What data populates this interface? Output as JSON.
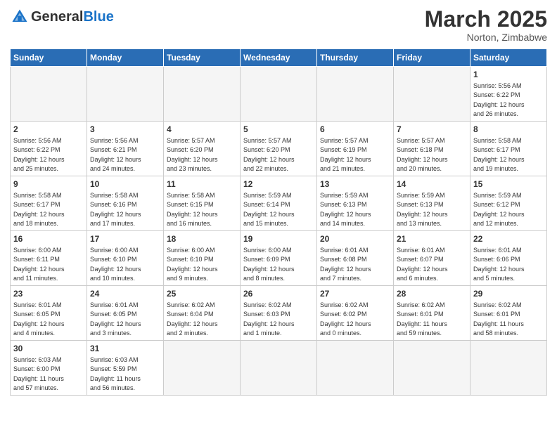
{
  "header": {
    "logo_general": "General",
    "logo_blue": "Blue",
    "month_title": "March 2025",
    "location": "Norton, Zimbabwe"
  },
  "weekdays": [
    "Sunday",
    "Monday",
    "Tuesday",
    "Wednesday",
    "Thursday",
    "Friday",
    "Saturday"
  ],
  "weeks": [
    [
      {
        "day": "",
        "info": "",
        "empty": true
      },
      {
        "day": "",
        "info": "",
        "empty": true
      },
      {
        "day": "",
        "info": "",
        "empty": true
      },
      {
        "day": "",
        "info": "",
        "empty": true
      },
      {
        "day": "",
        "info": "",
        "empty": true
      },
      {
        "day": "",
        "info": "",
        "empty": true
      },
      {
        "day": "1",
        "info": "Sunrise: 5:56 AM\nSunset: 6:22 PM\nDaylight: 12 hours\nand 26 minutes."
      }
    ],
    [
      {
        "day": "2",
        "info": "Sunrise: 5:56 AM\nSunset: 6:22 PM\nDaylight: 12 hours\nand 25 minutes."
      },
      {
        "day": "3",
        "info": "Sunrise: 5:56 AM\nSunset: 6:21 PM\nDaylight: 12 hours\nand 24 minutes."
      },
      {
        "day": "4",
        "info": "Sunrise: 5:57 AM\nSunset: 6:20 PM\nDaylight: 12 hours\nand 23 minutes."
      },
      {
        "day": "5",
        "info": "Sunrise: 5:57 AM\nSunset: 6:20 PM\nDaylight: 12 hours\nand 22 minutes."
      },
      {
        "day": "6",
        "info": "Sunrise: 5:57 AM\nSunset: 6:19 PM\nDaylight: 12 hours\nand 21 minutes."
      },
      {
        "day": "7",
        "info": "Sunrise: 5:57 AM\nSunset: 6:18 PM\nDaylight: 12 hours\nand 20 minutes."
      },
      {
        "day": "8",
        "info": "Sunrise: 5:58 AM\nSunset: 6:17 PM\nDaylight: 12 hours\nand 19 minutes."
      }
    ],
    [
      {
        "day": "9",
        "info": "Sunrise: 5:58 AM\nSunset: 6:17 PM\nDaylight: 12 hours\nand 18 minutes."
      },
      {
        "day": "10",
        "info": "Sunrise: 5:58 AM\nSunset: 6:16 PM\nDaylight: 12 hours\nand 17 minutes."
      },
      {
        "day": "11",
        "info": "Sunrise: 5:58 AM\nSunset: 6:15 PM\nDaylight: 12 hours\nand 16 minutes."
      },
      {
        "day": "12",
        "info": "Sunrise: 5:59 AM\nSunset: 6:14 PM\nDaylight: 12 hours\nand 15 minutes."
      },
      {
        "day": "13",
        "info": "Sunrise: 5:59 AM\nSunset: 6:13 PM\nDaylight: 12 hours\nand 14 minutes."
      },
      {
        "day": "14",
        "info": "Sunrise: 5:59 AM\nSunset: 6:13 PM\nDaylight: 12 hours\nand 13 minutes."
      },
      {
        "day": "15",
        "info": "Sunrise: 5:59 AM\nSunset: 6:12 PM\nDaylight: 12 hours\nand 12 minutes."
      }
    ],
    [
      {
        "day": "16",
        "info": "Sunrise: 6:00 AM\nSunset: 6:11 PM\nDaylight: 12 hours\nand 11 minutes."
      },
      {
        "day": "17",
        "info": "Sunrise: 6:00 AM\nSunset: 6:10 PM\nDaylight: 12 hours\nand 10 minutes."
      },
      {
        "day": "18",
        "info": "Sunrise: 6:00 AM\nSunset: 6:10 PM\nDaylight: 12 hours\nand 9 minutes."
      },
      {
        "day": "19",
        "info": "Sunrise: 6:00 AM\nSunset: 6:09 PM\nDaylight: 12 hours\nand 8 minutes."
      },
      {
        "day": "20",
        "info": "Sunrise: 6:01 AM\nSunset: 6:08 PM\nDaylight: 12 hours\nand 7 minutes."
      },
      {
        "day": "21",
        "info": "Sunrise: 6:01 AM\nSunset: 6:07 PM\nDaylight: 12 hours\nand 6 minutes."
      },
      {
        "day": "22",
        "info": "Sunrise: 6:01 AM\nSunset: 6:06 PM\nDaylight: 12 hours\nand 5 minutes."
      }
    ],
    [
      {
        "day": "23",
        "info": "Sunrise: 6:01 AM\nSunset: 6:05 PM\nDaylight: 12 hours\nand 4 minutes."
      },
      {
        "day": "24",
        "info": "Sunrise: 6:01 AM\nSunset: 6:05 PM\nDaylight: 12 hours\nand 3 minutes."
      },
      {
        "day": "25",
        "info": "Sunrise: 6:02 AM\nSunset: 6:04 PM\nDaylight: 12 hours\nand 2 minutes."
      },
      {
        "day": "26",
        "info": "Sunrise: 6:02 AM\nSunset: 6:03 PM\nDaylight: 12 hours\nand 1 minute."
      },
      {
        "day": "27",
        "info": "Sunrise: 6:02 AM\nSunset: 6:02 PM\nDaylight: 12 hours\nand 0 minutes."
      },
      {
        "day": "28",
        "info": "Sunrise: 6:02 AM\nSunset: 6:01 PM\nDaylight: 11 hours\nand 59 minutes."
      },
      {
        "day": "29",
        "info": "Sunrise: 6:02 AM\nSunset: 6:01 PM\nDaylight: 11 hours\nand 58 minutes."
      }
    ],
    [
      {
        "day": "30",
        "info": "Sunrise: 6:03 AM\nSunset: 6:00 PM\nDaylight: 11 hours\nand 57 minutes."
      },
      {
        "day": "31",
        "info": "Sunrise: 6:03 AM\nSunset: 5:59 PM\nDaylight: 11 hours\nand 56 minutes."
      },
      {
        "day": "",
        "info": "",
        "empty": true
      },
      {
        "day": "",
        "info": "",
        "empty": true
      },
      {
        "day": "",
        "info": "",
        "empty": true
      },
      {
        "day": "",
        "info": "",
        "empty": true
      },
      {
        "day": "",
        "info": "",
        "empty": true
      }
    ]
  ]
}
